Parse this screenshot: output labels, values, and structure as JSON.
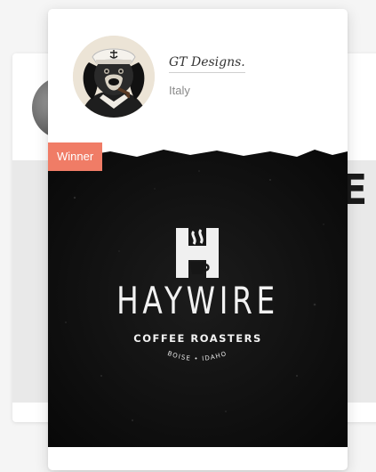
{
  "badge": {
    "label": "Winner",
    "color": "#f07c66"
  },
  "designer": {
    "name": "GT Designs.",
    "location": "Italy",
    "avatar_icon": "sailor-dog-avatar"
  },
  "artwork": {
    "brand_name": "HAYWIRE",
    "brand_sub": "COFFEE ROASTERS",
    "brand_location": "BOISE • IDAHO",
    "background_color": "#161616",
    "logo_icon": "h-coffee-cup-logo"
  },
  "background_card": {
    "artwork_text": "E"
  }
}
